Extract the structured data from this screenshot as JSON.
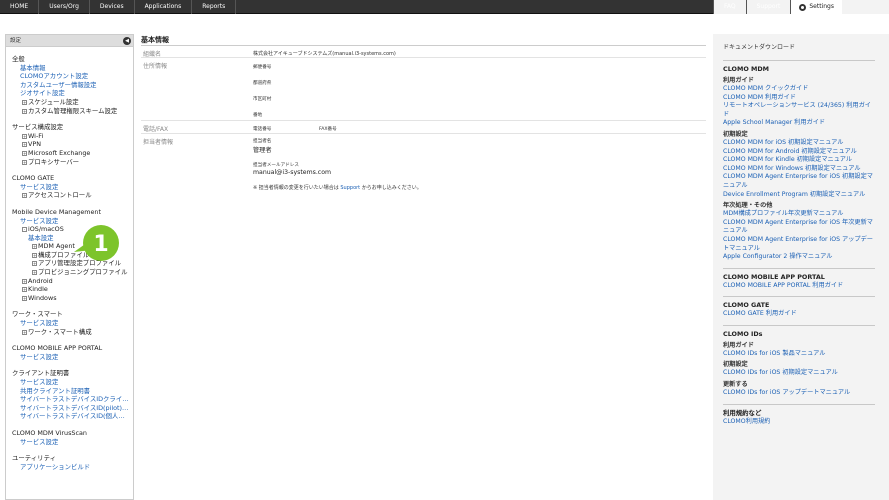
{
  "topnav": {
    "left": [
      "HOME",
      "Users/Org",
      "Devices",
      "Applications",
      "Reports"
    ],
    "faq": "FAQ",
    "support": "Support",
    "settings": "Settings"
  },
  "sidebar": {
    "header": "設定",
    "collapse_glyph": "◀",
    "general": {
      "title": "全般",
      "links": [
        "基本情報",
        "CLOMOアカウント設定",
        "カスタムユーザー情報設定",
        "ジオサイト設定"
      ],
      "expand": [
        "スケジュール設定",
        "カスタム管理権限スキーム設定"
      ]
    },
    "service": {
      "title": "サービス構成設定",
      "items": [
        "Wi-Fi",
        "VPN",
        "Microsoft Exchange",
        "プロキシサーバー"
      ]
    },
    "gate": {
      "title": "CLOMO GATE",
      "link": "サービス設定",
      "expand": "アクセスコントロール"
    },
    "mdm": {
      "title": "Mobile Device Management",
      "link": "サービス設定",
      "ios": "iOS/macOS",
      "ios_basic": "基本設定",
      "ios_children": [
        "MDM Agent",
        "構成プロファイル",
        "アプリ管理設定プロファイル",
        "プロビジョニングプロファイル"
      ],
      "others": [
        "Android",
        "Kindle",
        "Windows"
      ]
    },
    "worksmart": {
      "title": "ワーク・スマート",
      "link": "サービス設定",
      "expand": "ワーク・スマート構成"
    },
    "portal": {
      "title": "CLOMO MOBILE APP PORTAL",
      "link": "サービス設定"
    },
    "cert": {
      "title": "クライアント証明書",
      "links": [
        "サービス設定",
        "共用クライアント証明書",
        "サイバートラストデバイスIDクライ…",
        "サイバートラストデバイスID(pilot)…",
        "サイバートラストデバイスID(個人…"
      ]
    },
    "virus": {
      "title": "CLOMO MDM VirusScan",
      "link": "サービス設定"
    },
    "utility": {
      "title": "ユーティリティ",
      "link": "アプリケーションビルド"
    }
  },
  "callout": {
    "number": "1",
    "color": "#7dc42b"
  },
  "main": {
    "title": "基本情報",
    "org_label": "組織名",
    "org_value": "株式会社アイキューブドシステムズ(manual.i3-systems.com)",
    "address_label": "住所情報",
    "postal": "郵便番号",
    "prefecture": "都道府県",
    "city": "市区町村",
    "street": "番地",
    "phone_label": "電話/FAX",
    "phone": "電話番号",
    "fax": "FAX番号",
    "contact_label": "担当者情報",
    "contact_name_label": "担当者名",
    "contact_name": "管理者",
    "contact_mail_label": "担当者メールアドレス",
    "contact_mail": "manual@i3-systems.com",
    "note_prefix": "※ 担当者情報の変更を行いたい場合は ",
    "note_link": "Support",
    "note_suffix": " からお申し込みください。"
  },
  "right_panel": {
    "title": "ドキュメントダウンロード",
    "mdm": {
      "head": "CLOMO MDM",
      "guide_head": "利用ガイド",
      "guide_links": [
        "CLOMO MDM クイックガイド",
        "CLOMO MDM 利用ガイド",
        "リモートオペレーションサービス (24/365) 利用ガイド",
        "Apple School Manager 利用ガイド"
      ],
      "initial_head": "初期設定",
      "initial_links": [
        "CLOMO MDM for iOS 初期設定マニュアル",
        "CLOMO MDM for Android 初期設定マニュアル",
        "CLOMO MDM for Kindle 初期設定マニュアル",
        "CLOMO MDM for Windows 初期設定マニュアル",
        "CLOMO MDM Agent Enterprise for iOS 初期設定マニュアル",
        "Device Enrollment Program 初期設定マニュアル"
      ],
      "yearly_head": "年次処理・その他",
      "yearly_links": [
        "MDM構成プロファイル年次更新マニュアル",
        "CLOMO MDM Agent Enterprise for iOS 年次更新マニュアル",
        "CLOMO MDM Agent Enterprise for iOS アップデートマニュアル",
        "Apple Configurator 2 操作マニュアル"
      ]
    },
    "portal": {
      "head": "CLOMO MOBILE APP PORTAL",
      "link": "CLOMO MOBILE APP PORTAL 利用ガイド"
    },
    "gate": {
      "head": "CLOMO GATE",
      "link": "CLOMO GATE 利用ガイド"
    },
    "ids": {
      "head": "CLOMO IDs",
      "guide_head": "利用ガイド",
      "guide_link": "CLOMO IDs for iOS 製品マニュアル",
      "initial_head": "初期設定",
      "initial_link": "CLOMO IDs for iOS 初期設定マニュアル",
      "update_head": "更新する",
      "update_link": "CLOMO IDs for iOS アップデートマニュアル"
    },
    "terms": {
      "head": "利用規約など",
      "link": "CLOMO利用規約"
    }
  }
}
